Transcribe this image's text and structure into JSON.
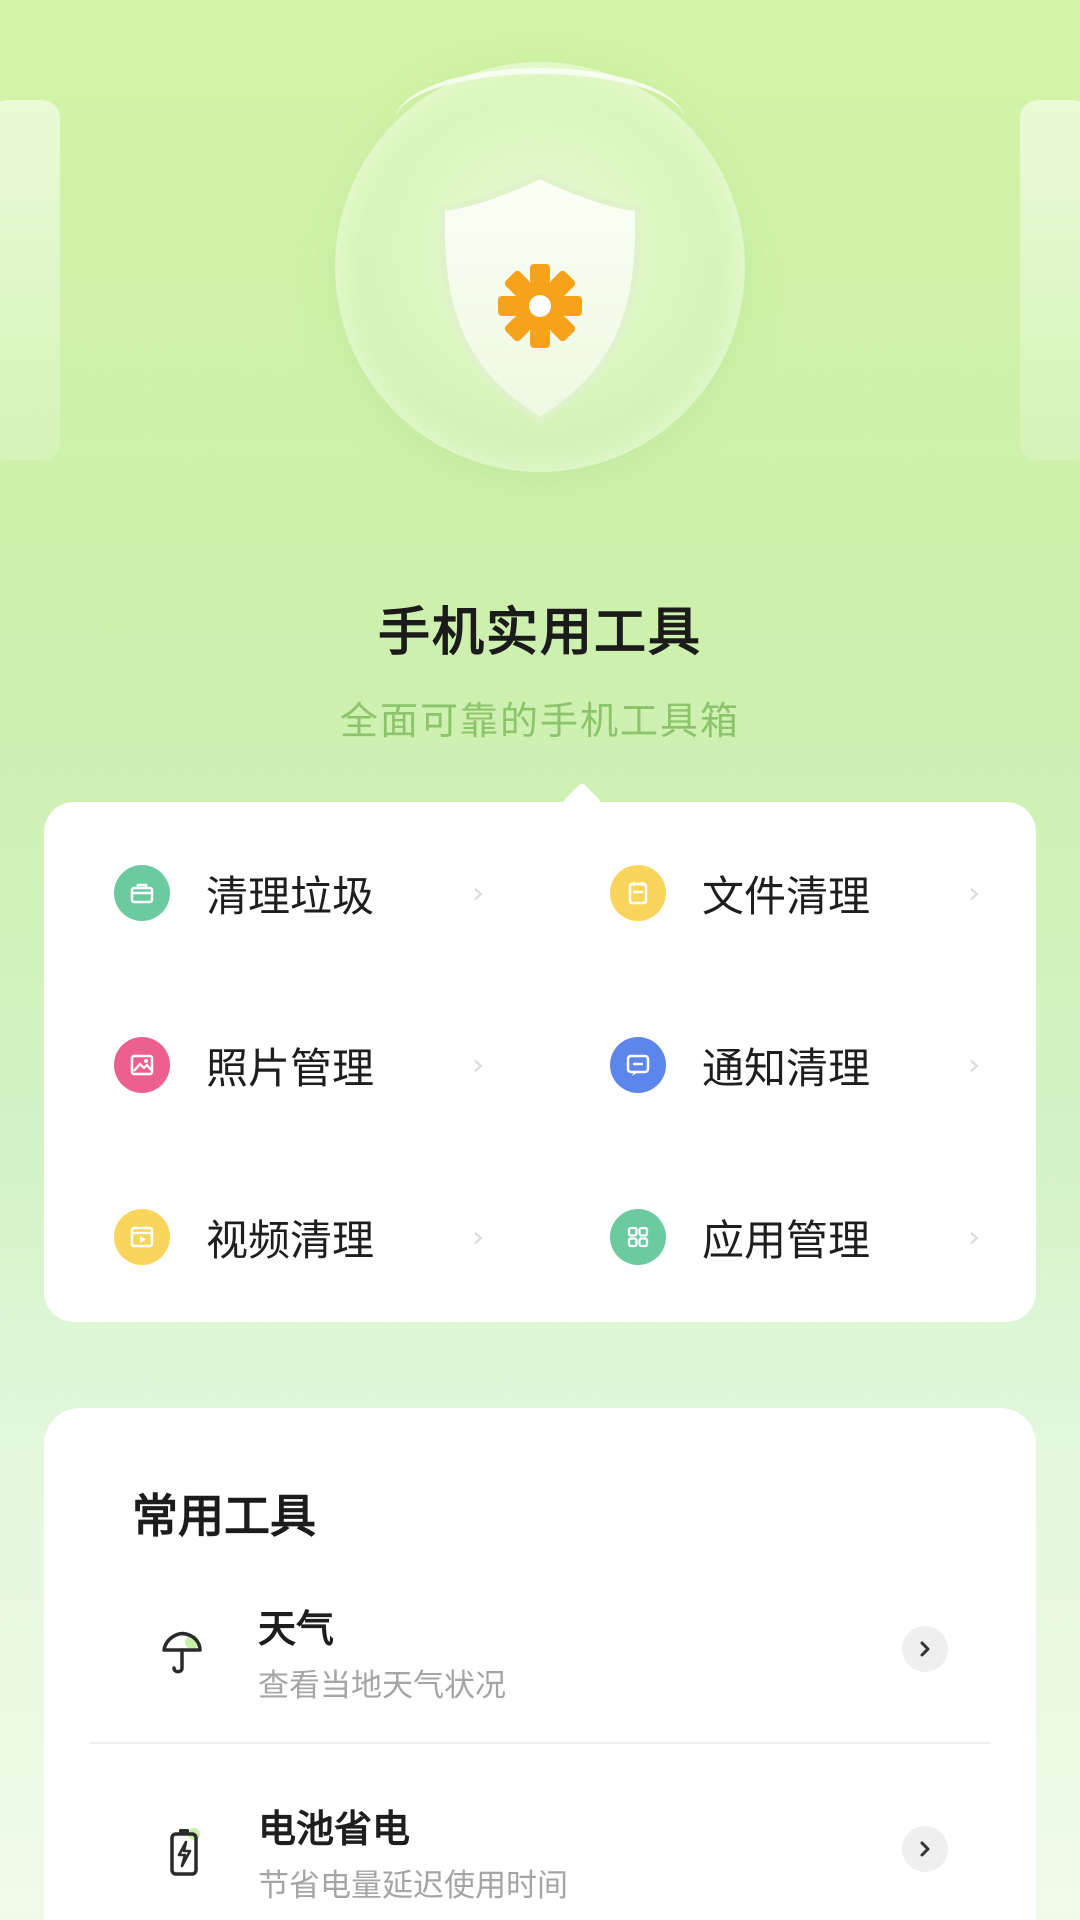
{
  "header": {
    "title": "手机实用工具",
    "subtitle": "全面可靠的手机工具箱"
  },
  "features": [
    {
      "label": "清理垃圾",
      "icon": "trash-box-icon",
      "color": "#6ccaa1"
    },
    {
      "label": "文件清理",
      "icon": "file-icon",
      "color": "#f9d65b"
    },
    {
      "label": "照片管理",
      "icon": "image-icon",
      "color": "#ec5f8e"
    },
    {
      "label": "通知清理",
      "icon": "message-icon",
      "color": "#5d86ec"
    },
    {
      "label": "视频清理",
      "icon": "video-icon",
      "color": "#f9d65b"
    },
    {
      "label": "应用管理",
      "icon": "apps-grid-icon",
      "color": "#6ccaa1"
    }
  ],
  "tools": {
    "title": "常用工具",
    "items": [
      {
        "name": "天气",
        "desc": "查看当地天气状况",
        "icon": "umbrella-icon"
      },
      {
        "name": "电池省电",
        "desc": "节省电量延迟使用时间",
        "icon": "battery-icon"
      }
    ]
  },
  "colors": {
    "accent_green": "#8cc46a",
    "shield_badge": "#f7a21b"
  }
}
